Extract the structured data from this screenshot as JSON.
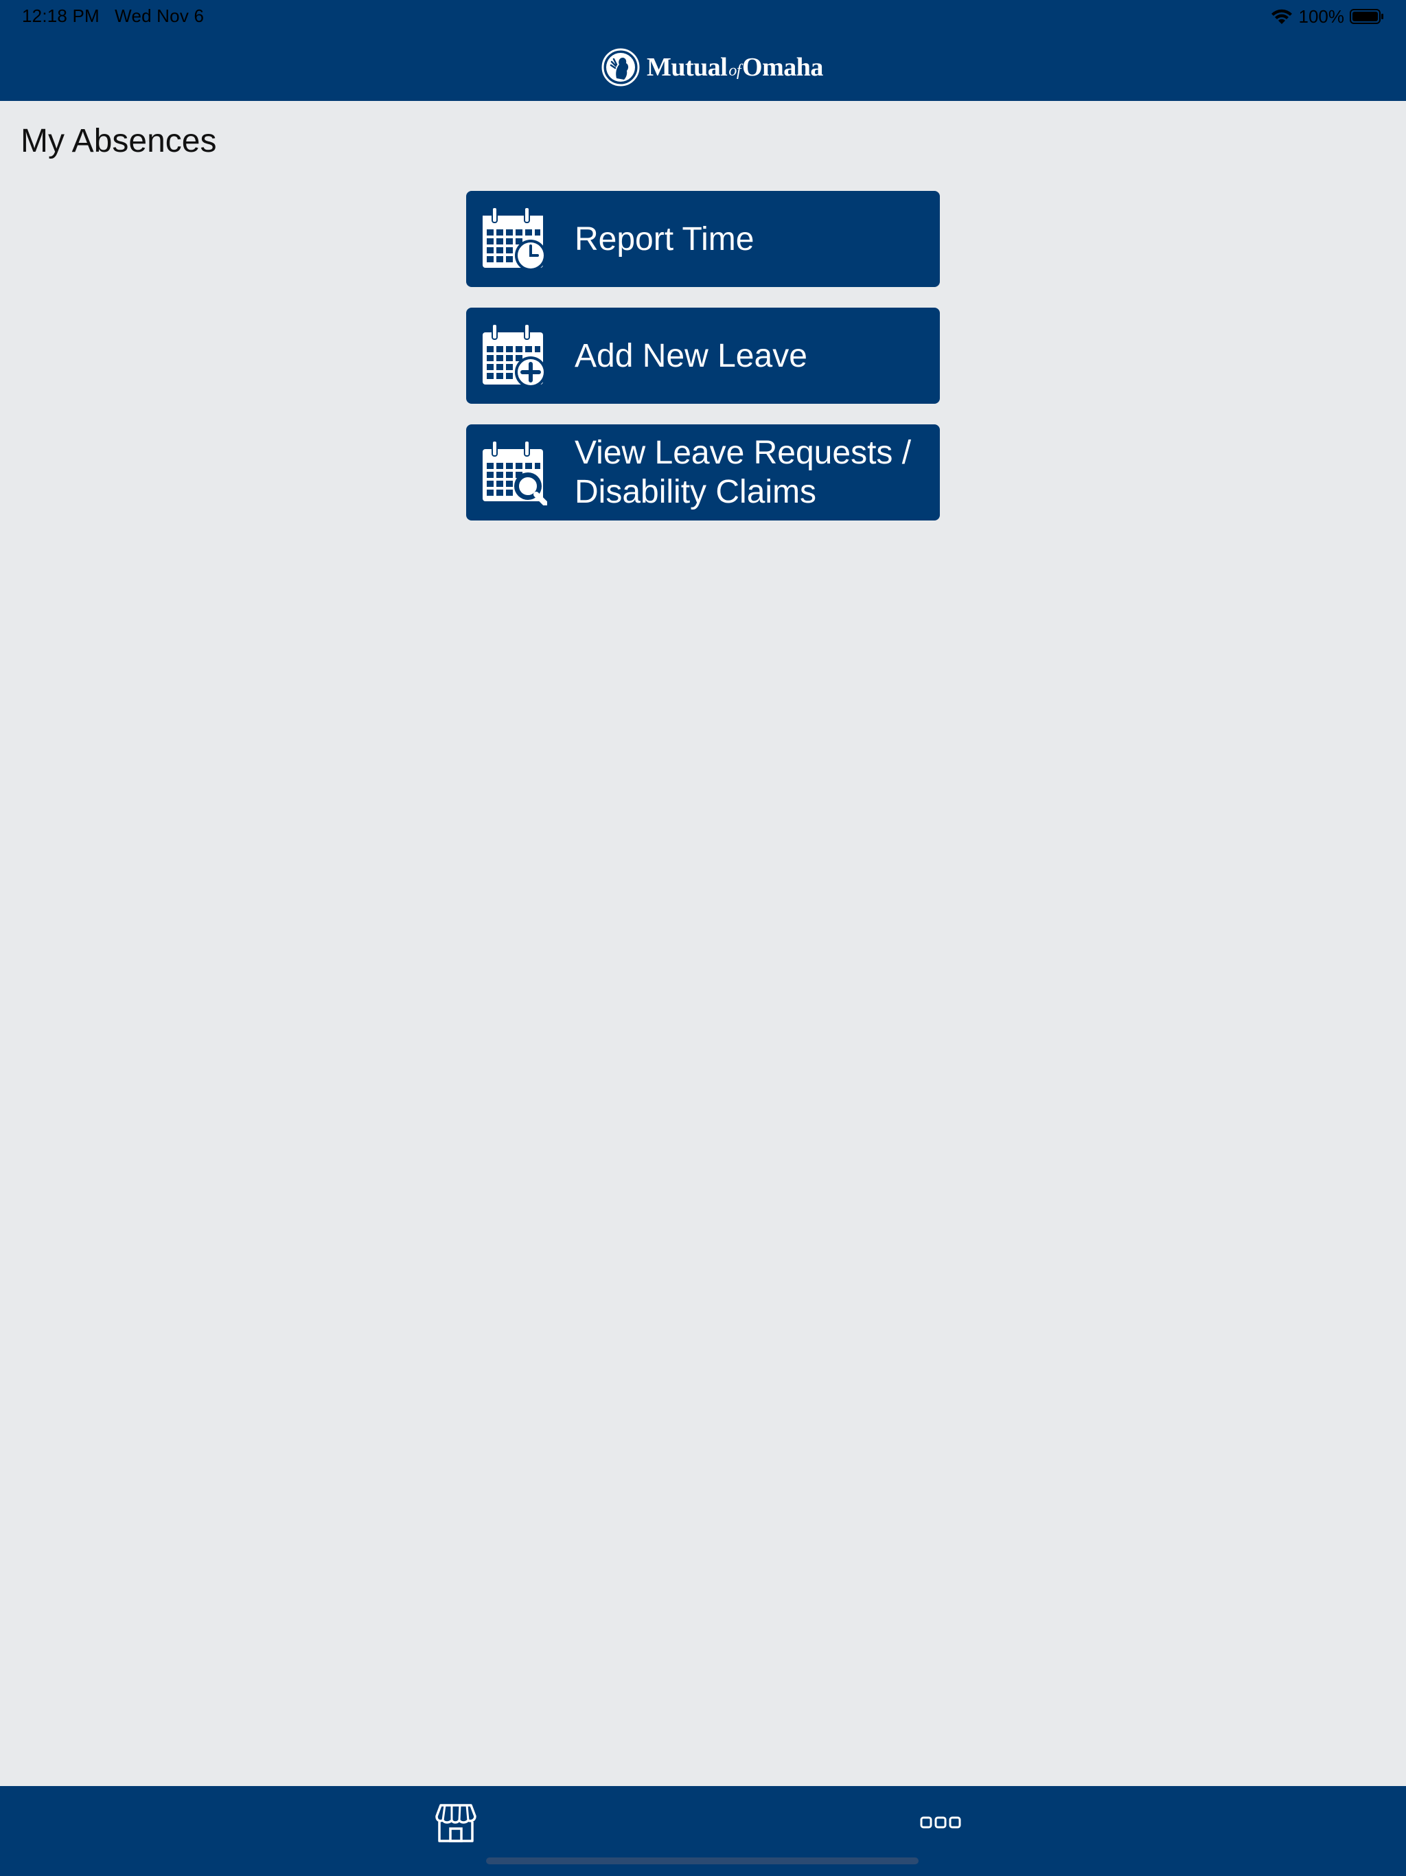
{
  "status_bar": {
    "time": "12:18 PM",
    "date": "Wed Nov 6",
    "battery": "100%"
  },
  "header": {
    "logo_text_left": "Mutual",
    "logo_text_of": "of",
    "logo_text_right": "Omaha"
  },
  "page": {
    "title": "My Absences"
  },
  "menu": {
    "items": [
      {
        "label": "Report Time",
        "icon": "calendar-clock-icon"
      },
      {
        "label": "Add New Leave",
        "icon": "calendar-plus-icon"
      },
      {
        "label_line1": "View Leave Requests /",
        "label_line2": "Disability Claims",
        "icon": "calendar-search-icon"
      }
    ]
  },
  "tab_bar": {
    "items": [
      {
        "icon": "storefront-icon"
      },
      {
        "icon": "more-icon"
      }
    ]
  },
  "colors": {
    "brand_navy": "#003a72",
    "background": "#e8eaec"
  }
}
